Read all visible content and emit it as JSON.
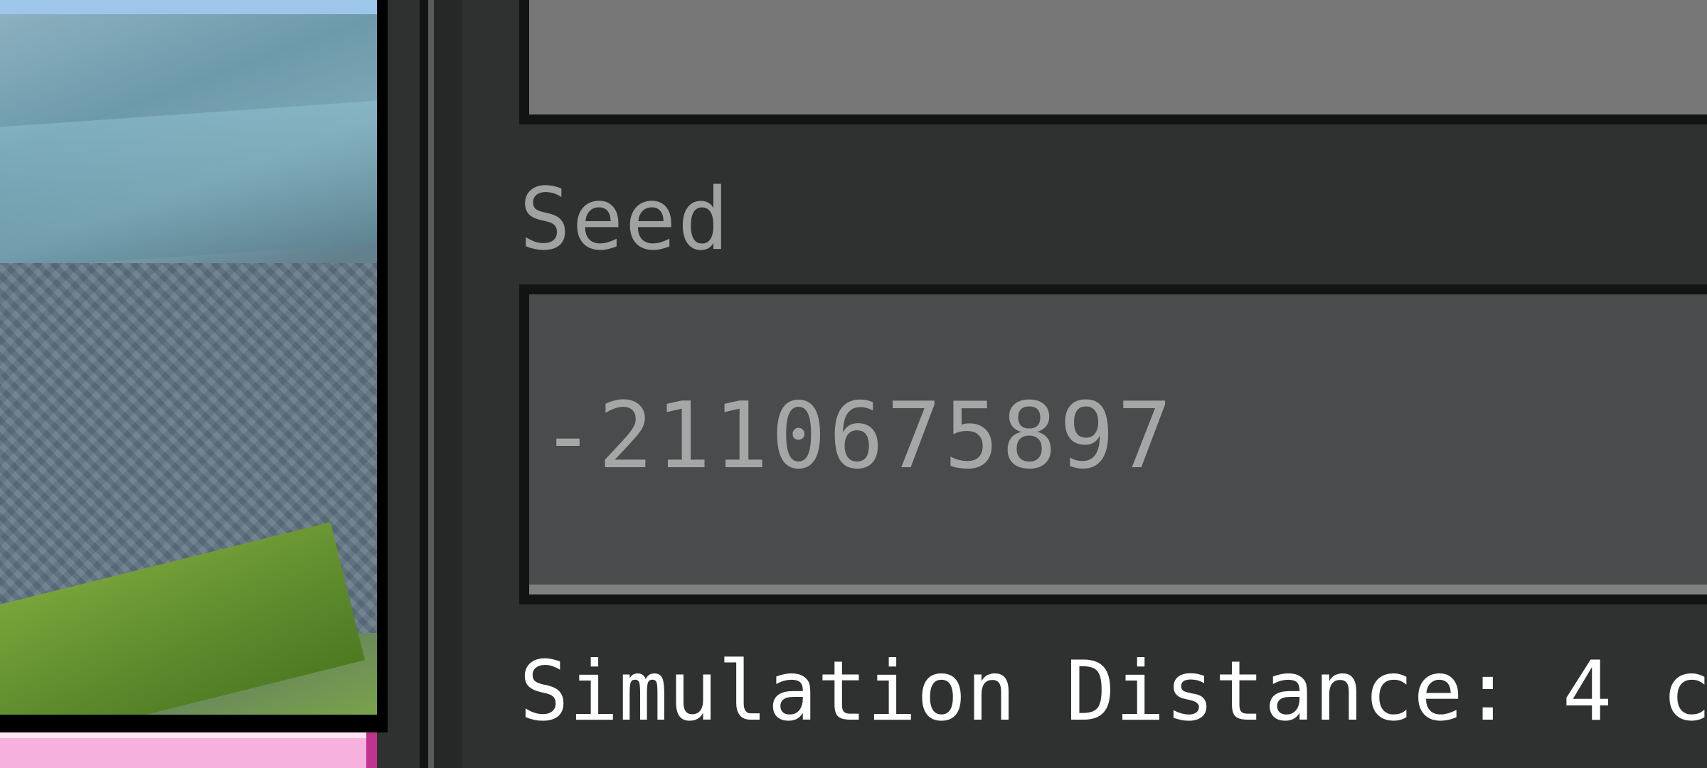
{
  "world_options": {
    "seed": {
      "label": "Seed",
      "value": "-2110675897"
    },
    "simulation_distance": {
      "label_text": "Simulation Distance: 4 c"
    }
  },
  "colors": {
    "panel_background": "#2f3131",
    "field_background": "#4a4b4c",
    "field_border": "#121313",
    "label_text": "#a0a2a2",
    "value_text": "#a5a7a7",
    "slider_label_text": "#ffffff",
    "accent_pink": "#f7b1df"
  }
}
